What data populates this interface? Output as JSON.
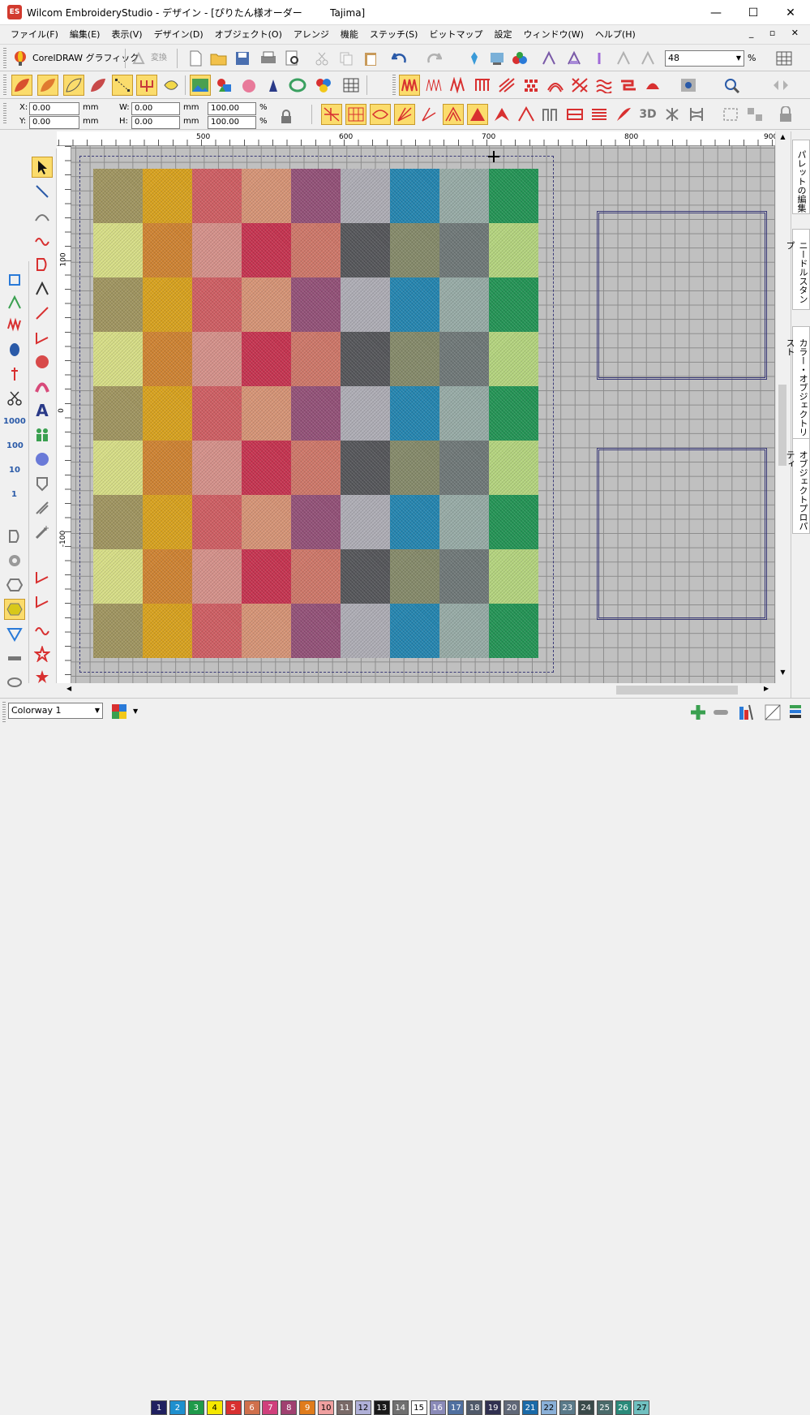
{
  "window": {
    "app_icon": "ES",
    "title": "Wilcom EmbroideryStudio - デザイン - [ぴりたん様オーダー         Tajima]",
    "minimize": "—",
    "maximize": "☐",
    "close": "✕"
  },
  "menu": [
    "ファイル(F)",
    "編集(E)",
    "表示(V)",
    "デザイン(D)",
    "オブジェクト(O)",
    "アレンジ",
    "機能",
    "ステッチ(S)",
    "ビットマップ",
    "設定",
    "ウィンドウ(W)",
    "ヘルプ(H)"
  ],
  "mdi_controls": "_ ▫ ✕",
  "toolbar1": {
    "coreldraw_label": "CorelDRAW グラフィック",
    "convert_label": "変換",
    "zoom_value": "48",
    "zoom_unit": "%"
  },
  "props": {
    "x_label": "X:",
    "x_value": "0.00",
    "x_unit": "mm",
    "y_label": "Y:",
    "y_value": "0.00",
    "y_unit": "mm",
    "w_label": "W:",
    "w_value": "0.00",
    "w_unit": "mm",
    "h_label": "H:",
    "h_value": "0.00",
    "h_unit": "mm",
    "w_pct": "100.00",
    "h_pct": "100.00",
    "pct": "%"
  },
  "ruler": {
    "top_ticks": [
      "500",
      "600",
      "700",
      "800",
      "900"
    ],
    "left_ticks": [
      "100",
      "0",
      "-100"
    ]
  },
  "left_tools_labels": [
    "1000",
    "100",
    "10",
    "1"
  ],
  "side_tabs": [
    "パレットの編集",
    "ニードルスタンプ",
    "カラー・オブジェクトリスト",
    "オブジェクトプロパティ"
  ],
  "colorway": "Colorway 1",
  "swatch_colors": [
    [
      "#a09560",
      "#d8a21e",
      "#cf5e63",
      "#d69476",
      "#935178",
      "#aeadb5",
      "#2485b0",
      "#97aba6",
      "#239455"
    ],
    [
      "#d7de86",
      "#cf8332",
      "#d5918a",
      "#c63350",
      "#ce7769",
      "#55565a",
      "#858a6a",
      "#6f7878",
      "#b4d47e"
    ]
  ],
  "palette": [
    {
      "n": "1",
      "c": "#202060"
    },
    {
      "n": "2",
      "c": "#1f8fce"
    },
    {
      "n": "3",
      "c": "#1f9a4a"
    },
    {
      "n": "4",
      "c": "#f5e800"
    },
    {
      "n": "5",
      "c": "#d83030"
    },
    {
      "n": "6",
      "c": "#d0704c"
    },
    {
      "n": "7",
      "c": "#d0407c"
    },
    {
      "n": "8",
      "c": "#a04070"
    },
    {
      "n": "9",
      "c": "#e07c1c"
    },
    {
      "n": "10",
      "c": "#f0a0a0"
    },
    {
      "n": "11",
      "c": "#7a6a68"
    },
    {
      "n": "12",
      "c": "#b0b0d8"
    },
    {
      "n": "13",
      "c": "#1a1a1a"
    },
    {
      "n": "14",
      "c": "#707070"
    },
    {
      "n": "15",
      "c": "#ffffff"
    },
    {
      "n": "16",
      "c": "#8a8ab8"
    },
    {
      "n": "17",
      "c": "#5070a0"
    },
    {
      "n": "18",
      "c": "#505a6a"
    },
    {
      "n": "19",
      "c": "#303050"
    },
    {
      "n": "20",
      "c": "#606878"
    },
    {
      "n": "21",
      "c": "#1a6aa8"
    },
    {
      "n": "22",
      "c": "#8ab0d8"
    },
    {
      "n": "23",
      "c": "#5a7a8a"
    },
    {
      "n": "24",
      "c": "#3a4a4a"
    },
    {
      "n": "25",
      "c": "#4a6a6a"
    },
    {
      "n": "26",
      "c": "#2a8a7a"
    },
    {
      "n": "27",
      "c": "#70c0c0"
    }
  ]
}
